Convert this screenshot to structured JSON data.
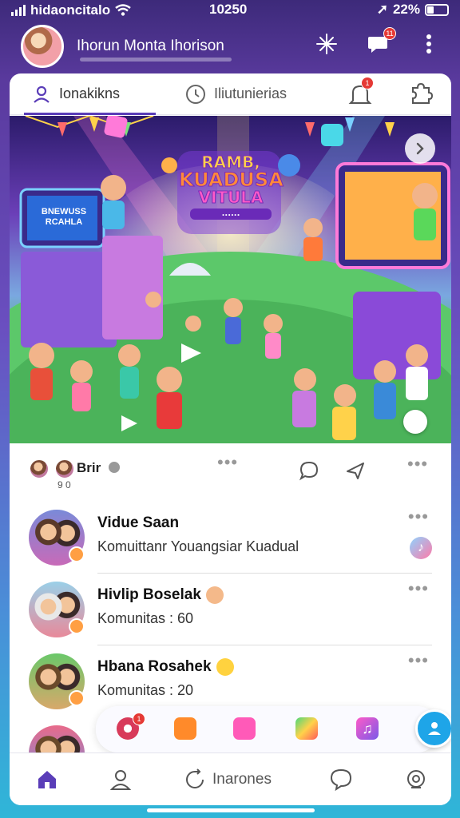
{
  "status_bar": {
    "carrier": "hidaoncitalo",
    "time": "10250",
    "battery": "22%"
  },
  "header": {
    "title": "Ihorun Monta Ihorison",
    "chat_badge": "11"
  },
  "tabs": [
    {
      "label": "Ionakikns"
    },
    {
      "label": "Iliutunierias"
    }
  ],
  "tab_bell_badge": "1",
  "hero": {
    "title_line1": "RAMB,",
    "title_line2": "KUADUSA",
    "title_line3": "VITULA",
    "title_sub": "......",
    "screen_left_line1": "BNEWUSS",
    "screen_left_line2": "RCAHLA"
  },
  "post": {
    "author": "Brir",
    "sub": "9 0"
  },
  "list": [
    {
      "name": "Vidue Saan",
      "sub": "Komuittanr Youangsiar Kuadual"
    },
    {
      "name": "Hivlip Boselak",
      "sub": "Komunitas : 60"
    },
    {
      "name": "Hbana Rosahek",
      "sub": "Komunitas : 20"
    },
    {
      "name": "",
      "sub": ""
    }
  ],
  "tray_badge": "1",
  "bottom_nav": {
    "center_label": "Inarones"
  },
  "colors": {
    "accent": "#5a3db8",
    "fab": "#1ea5e8",
    "badge": "#e53935"
  }
}
